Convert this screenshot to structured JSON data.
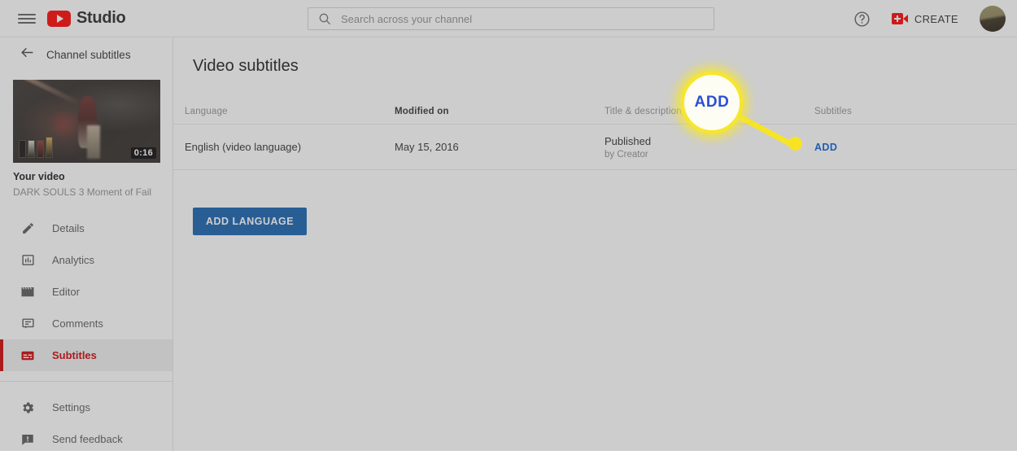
{
  "header": {
    "menu_icon": "hamburger-icon",
    "brand": "Studio",
    "brand_icon": "youtube-logo-icon",
    "search": {
      "icon": "search-icon",
      "placeholder": "Search across your channel",
      "value": ""
    },
    "help_icon": "help-circle-icon",
    "create": {
      "label": "CREATE",
      "icon": "video-camera-plus-icon"
    },
    "avatar": "account-avatar"
  },
  "sidebar": {
    "back": {
      "icon": "arrow-left-icon",
      "label": "Channel subtitles"
    },
    "video": {
      "thumbnail_alt": "video-thumbnail",
      "duration": "0:16",
      "label": "Your video",
      "title": "DARK SOULS 3 Moment of Fail"
    },
    "items": [
      {
        "label": "Details",
        "icon": "pencil-icon",
        "active": false
      },
      {
        "label": "Analytics",
        "icon": "bar-chart-icon",
        "active": false
      },
      {
        "label": "Editor",
        "icon": "clapperboard-icon",
        "active": false
      },
      {
        "label": "Comments",
        "icon": "comment-icon",
        "active": false
      },
      {
        "label": "Subtitles",
        "icon": "subtitles-icon",
        "active": true
      }
    ],
    "footer_items": [
      {
        "label": "Settings",
        "icon": "gear-icon"
      },
      {
        "label": "Send feedback",
        "icon": "feedback-icon"
      }
    ]
  },
  "main": {
    "title": "Video subtitles",
    "table": {
      "columns": [
        {
          "key": "language",
          "label": "Language",
          "sorted": false
        },
        {
          "key": "modified",
          "label": "Modified on",
          "sorted": true
        },
        {
          "key": "title",
          "label": "Title & description",
          "sorted": false
        },
        {
          "key": "subtitles",
          "label": "Subtitles",
          "sorted": false
        }
      ],
      "rows": [
        {
          "language": "English (video language)",
          "modified": "May 15, 2016",
          "status": "Published",
          "status_by": "by Creator",
          "action": "ADD"
        }
      ]
    },
    "add_language_button": "ADD LANGUAGE"
  },
  "callout": {
    "text": "ADD",
    "text_color": "#2b4fd6",
    "ring_color": "#f7e62c",
    "dot_color": "#f7e324"
  },
  "colors": {
    "brand_red": "#ff0000",
    "active_red": "#cc0000",
    "link_blue": "#065fd4",
    "button_blue": "#1560ad",
    "highlight_yellow": "#f7e62c"
  }
}
